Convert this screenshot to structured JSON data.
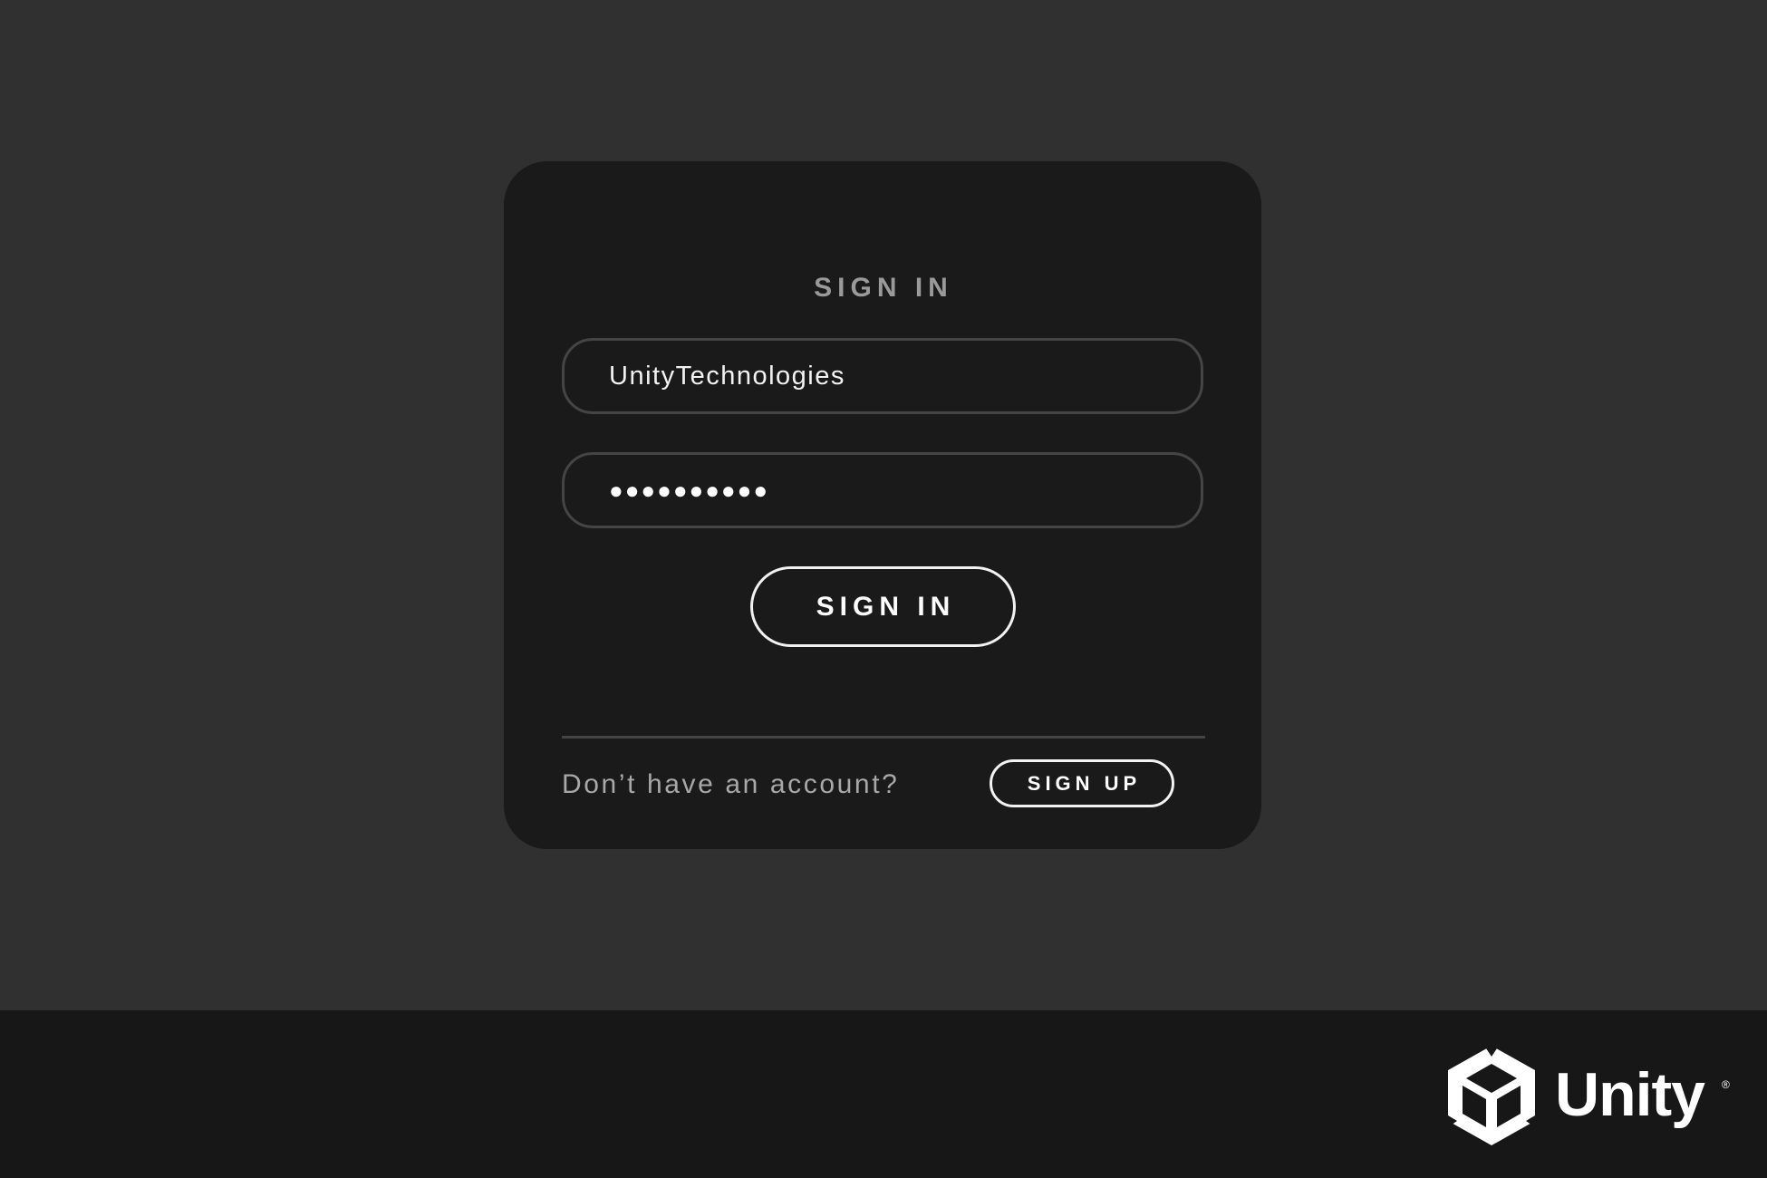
{
  "signin": {
    "title": "SIGN IN",
    "username_value": "UnityTechnologies",
    "password_value": "●●●●●●●●●●",
    "submit_label": "SIGN IN"
  },
  "signup": {
    "prompt": "Don’t have an account?",
    "button_label": "SIGN UP"
  },
  "footer": {
    "logo_wordmark": "Unity",
    "logo_registered": "®",
    "logo_icon": "unity-cube-icon"
  },
  "colors": {
    "page_background": "#303030",
    "card_background": "#1a1a1a",
    "footer_background": "#171717",
    "field_border": "#454545",
    "text_primary": "#ffffff",
    "text_muted": "#9a9a9a"
  }
}
